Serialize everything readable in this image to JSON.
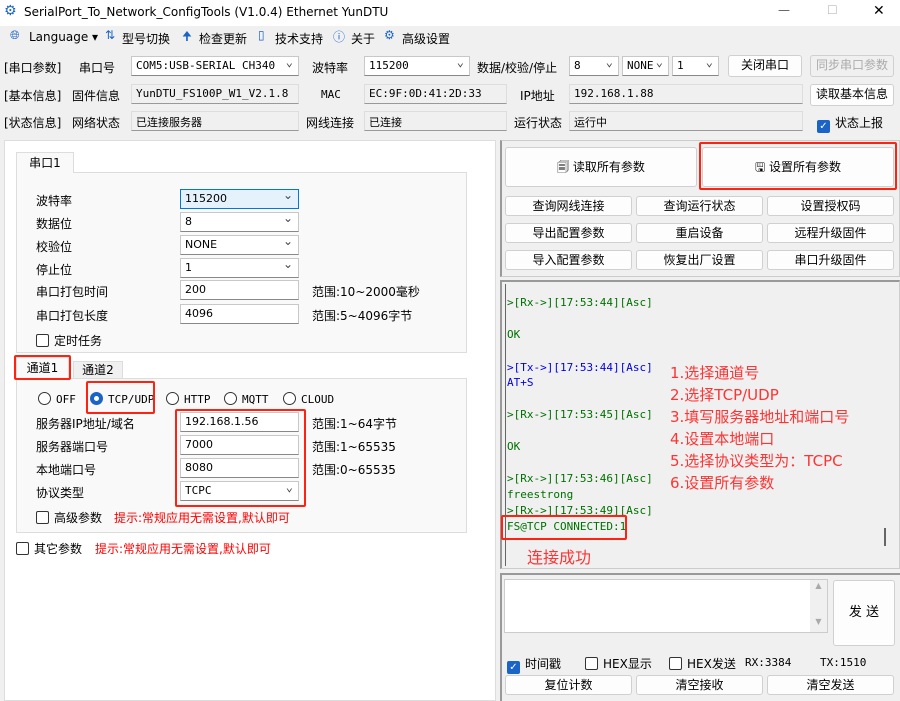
{
  "window": {
    "title": "SerialPort_To_Network_ConfigTools (V1.0.4) Ethernet YunDTU",
    "minimize": "—",
    "maximize": "☐",
    "close": "✕"
  },
  "toolbar": [
    {
      "icon": "globe",
      "label": "Language ▾"
    },
    {
      "icon": "switch",
      "label": "型号切换"
    },
    {
      "icon": "upload",
      "label": "检查更新"
    },
    {
      "icon": "doc",
      "label": "技术支持"
    },
    {
      "icon": "info",
      "label": "关于"
    },
    {
      "icon": "gear",
      "label": "高级设置"
    }
  ],
  "serial": {
    "section": "[串口参数]",
    "port_label": "串口号",
    "port": "COM5:USB-SERIAL CH340",
    "baud_label": "波特率",
    "baud": "115200",
    "dps_label": "数据/校验/停止",
    "data": "8",
    "parity": "NONE",
    "stop": "1",
    "close_btn": "关闭串口",
    "sync_btn": "同步串口参数"
  },
  "basic": {
    "section": "[基本信息]",
    "fw_label": "固件信息",
    "fw": "YunDTU_FS100P_W1_V2.1.8",
    "mac_label": "MAC",
    "mac": "EC:9F:0D:41:2D:33",
    "ip_label": "IP地址",
    "ip": "192.168.1.88",
    "read_btn": "读取基本信息"
  },
  "status": {
    "section": "[状态信息]",
    "net_label": "网络状态",
    "net": "已连接服务器",
    "cable_label": "网线连接",
    "cable": "已连接",
    "run_label": "运行状态",
    "run": "运行中",
    "report": "状态上报"
  },
  "uart": {
    "tab": "串口1",
    "rows": [
      {
        "label": "波特率",
        "value": "115200"
      },
      {
        "label": "数据位",
        "value": "8"
      },
      {
        "label": "校验位",
        "value": "NONE"
      },
      {
        "label": "停止位",
        "value": "1"
      },
      {
        "label": "串口打包时间",
        "value": "200",
        "range": "范围:10~2000毫秒"
      },
      {
        "label": "串口打包长度",
        "value": "4096",
        "range": "范围:5~4096字节"
      }
    ],
    "timer": "定时任务"
  },
  "channel": {
    "tabs": [
      "通道1",
      "通道2"
    ],
    "modes": [
      "OFF",
      "TCP/UDP",
      "HTTP",
      "MQTT",
      "CLOUD"
    ],
    "rows": [
      {
        "label": "服务器IP地址/域名",
        "value": "192.168.1.56",
        "range": "范围:1~64字节"
      },
      {
        "label": "服务器端口号",
        "value": "7000",
        "range": "范围:1~65535"
      },
      {
        "label": "本地端口号",
        "value": "8080",
        "range": "范围:0~65535"
      },
      {
        "label": "协议类型",
        "value": "TCPC"
      }
    ],
    "adv": "高级参数",
    "hint": "提示:常规应用无需设置,默认即可"
  },
  "other": {
    "label": "其它参数",
    "hint": "提示:常规应用无需设置,默认即可"
  },
  "actions": {
    "read_all": "读取所有参数",
    "set_all": "设置所有参数",
    "grid": [
      "查询网线连接",
      "查询运行状态",
      "设置授权码",
      "导出配置参数",
      "重启设备",
      "远程升级固件",
      "导入配置参数",
      "恢复出厂设置",
      "串口升级固件"
    ]
  },
  "log": [
    {
      "t": ">[Rx->][17:53:44][Asc]",
      "c": "g"
    },
    {
      "t": "OK",
      "c": "g"
    },
    {
      "t": ">[Tx->][17:53:44][Asc]",
      "c": "b"
    },
    {
      "t": "AT+S",
      "c": "b"
    },
    {
      "t": ">[Rx->][17:53:45][Asc]",
      "c": "g"
    },
    {
      "t": "OK",
      "c": "g"
    },
    {
      "t": ">[Rx->][17:53:46][Asc]",
      "c": "g"
    },
    {
      "t": "freestrong",
      "c": "g"
    },
    {
      "t": ">[Rx->][17:53:49][Asc]",
      "c": "g"
    },
    {
      "t": "FS@TCP CONNECTED:1",
      "c": "g"
    }
  ],
  "annotations": {
    "steps": [
      "1.选择通道号",
      "2.选择TCP/UDP",
      "3.填写服务器地址和端口号",
      "4.设置本地端口",
      "5.选择协议类型为：TCPC",
      "6.设置所有参数"
    ],
    "success": "连接成功"
  },
  "send": {
    "button": "发 送",
    "timestamp": "时间戳",
    "hex_show": "HEX显示",
    "hex_send": "HEX发送",
    "rx": "RX:3384",
    "tx": "TX:1510",
    "reset": "复位计数",
    "clear_rx": "清空接收",
    "clear_tx": "清空发送"
  },
  "colors": {
    "accent": "#1a64c8",
    "annotation": "#ff2211"
  }
}
